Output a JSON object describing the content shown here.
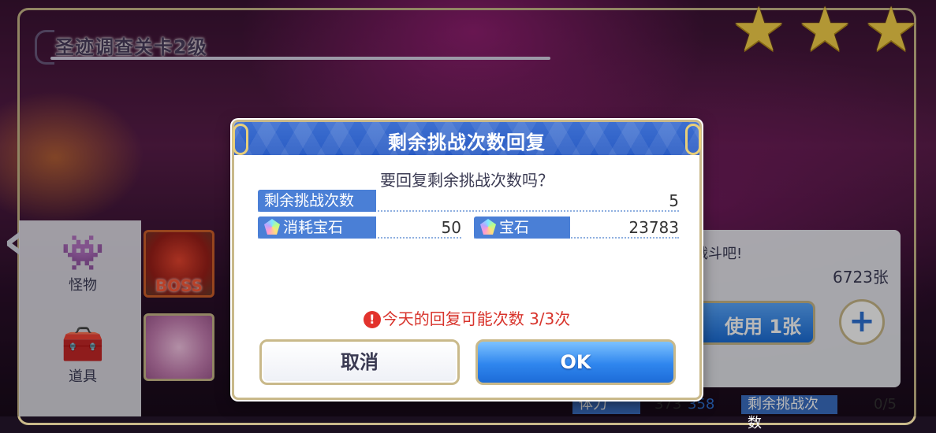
{
  "stage": {
    "title": "圣迹调查关卡2级",
    "stars": 3
  },
  "sidebar": {
    "items": [
      {
        "label": "怪物",
        "icon": "monster-icon"
      },
      {
        "label": "道具",
        "icon": "treasure-chest-icon"
      }
    ],
    "boss_label": "BOSS"
  },
  "right_panel": {
    "message_fragment": "战斗吧!",
    "ticket_count": "6723张",
    "use_button": "使用 1张",
    "plus": "+"
  },
  "bottom_strip": {
    "stamina_label": "体力",
    "stamina_value": "373",
    "stamina_next": "358",
    "challenge_label": "剩余挑战次数",
    "challenge_value": "0/5"
  },
  "dialog": {
    "title": "剩余挑战次数回复",
    "question": "要回复剩余挑战次数吗？",
    "rows": {
      "remaining": {
        "label": "剩余挑战次数",
        "value": "5"
      },
      "cost": {
        "label": "消耗宝石",
        "value": "50"
      },
      "gems": {
        "label": "宝石",
        "value": "23783"
      }
    },
    "warning": "今天的回复可能次数 3/3次",
    "warning_icon": "!",
    "cancel_label": "取消",
    "ok_label": "OK"
  },
  "colors": {
    "accent": "#3d6fd0",
    "gold": "#c9b98a",
    "warning": "#d8342c",
    "star": "#f7d24a"
  }
}
